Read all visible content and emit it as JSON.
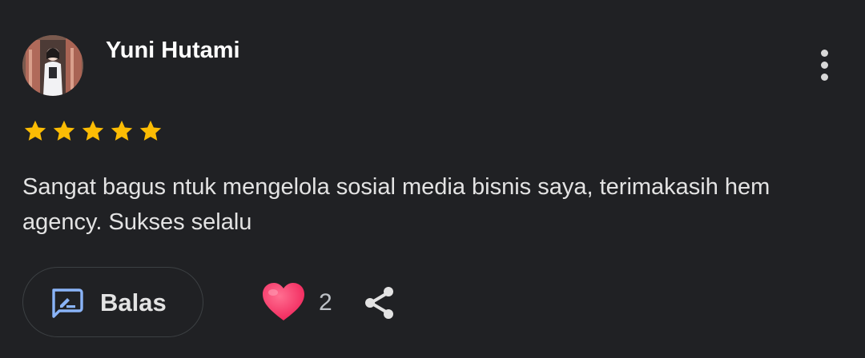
{
  "review": {
    "author": "Yuni Hutami",
    "rating": 5,
    "rating_max": 5,
    "text": "Sangat bagus ntuk mengelola sosial media bisnis saya, terimakasih hem agency. Sukses selalu"
  },
  "actions": {
    "reply_label": "Balas",
    "like_count": "2"
  },
  "icons": {
    "more": "more-vert-icon",
    "star": "star-icon",
    "reply": "reply-icon",
    "like": "heart-icon",
    "share": "share-icon"
  },
  "colors": {
    "background": "#202124",
    "star": "#fbbc04",
    "reply_icon": "#8ab4f8",
    "heart": "#ff3d6e"
  }
}
